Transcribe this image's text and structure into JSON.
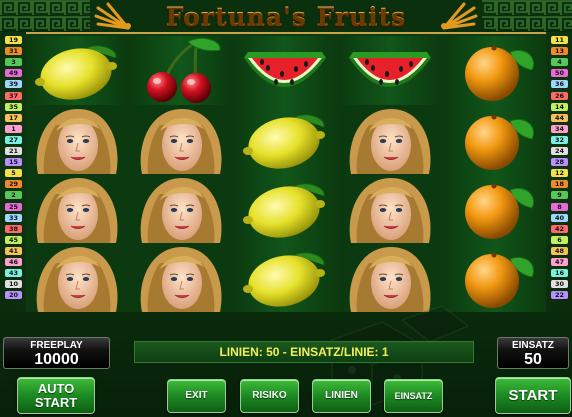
{
  "title": "Fortuna's Fruits",
  "reels": [
    [
      "lemon",
      "lady",
      "lady",
      "lady"
    ],
    [
      "cherry",
      "lady",
      "lady",
      "lady"
    ],
    [
      "watermelon",
      "lemon",
      "lemon",
      "lemon"
    ],
    [
      "watermelon",
      "lady",
      "lady",
      "lady"
    ],
    [
      "orange",
      "orange",
      "orange",
      "orange"
    ]
  ],
  "paylines_left": [
    "19",
    "31",
    "3",
    "49",
    "39",
    "37",
    "35",
    "17",
    "1",
    "27",
    "21",
    "15",
    "5",
    "29",
    "2",
    "25",
    "33",
    "38",
    "45",
    "41",
    "46",
    "43",
    "10",
    "20"
  ],
  "paylines_right": [
    "11",
    "13",
    "4",
    "50",
    "36",
    "26",
    "14",
    "44",
    "34",
    "32",
    "24",
    "28",
    "12",
    "18",
    "9",
    "8",
    "40",
    "42",
    "6",
    "48",
    "47",
    "16",
    "30",
    "22"
  ],
  "payline_colors": [
    "#f2e14a",
    "#f28a2a",
    "#56c85a",
    "#e86ad8",
    "#9fd8ff",
    "#ff6a6a",
    "#c0f060",
    "#f5c15a",
    "#ffa0d0",
    "#7af0e0",
    "#e0e0e0",
    "#b890ff"
  ],
  "freeplay": {
    "label": "FREEPLAY",
    "value": "10000"
  },
  "einsatz": {
    "label": "EINSATZ",
    "value": "50"
  },
  "info_bar": "LINIEN: 50  -  EINSATZ/LINIE: 1",
  "buttons": {
    "auto_start": [
      "AUTO",
      "START"
    ],
    "exit": "EXIT",
    "risiko": "RISIKO",
    "linien": "LINIEN",
    "einsatz": "EINSATZ",
    "start": "START"
  }
}
